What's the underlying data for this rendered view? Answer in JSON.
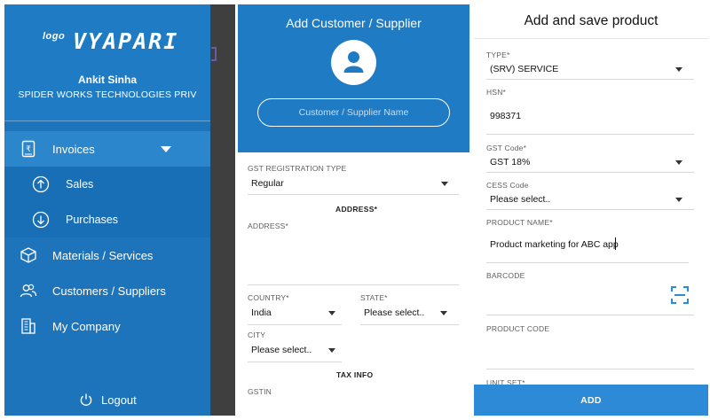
{
  "nav_drawer": {
    "brand_small": "logo",
    "brand_big": "VYAPARI",
    "user_name": "Ankit Sinha",
    "company": "SPIDER WORKS TECHNOLOGIES PRIV",
    "items": [
      {
        "label": "Invoices",
        "icon": "invoice-icon"
      },
      {
        "label": "Sales",
        "icon": "arrow-up-circle-icon"
      },
      {
        "label": "Purchases",
        "icon": "arrow-down-circle-icon"
      },
      {
        "label": "Materials / Services",
        "icon": "box-icon"
      },
      {
        "label": "Customers / Suppliers",
        "icon": "people-icon"
      },
      {
        "label": "My Company",
        "icon": "building-icon"
      }
    ],
    "logout_label": "Logout"
  },
  "customer_form": {
    "title": "Add Customer / Supplier",
    "name_placeholder": "Customer / Supplier Name",
    "gst_type_label": "GST REGISTRATION TYPE",
    "gst_type_value": "Regular",
    "address_heading": "ADDRESS*",
    "address_label": "ADDRESS*",
    "country_label": "COUNTRY*",
    "country_value": "India",
    "state_label": "STATE*",
    "state_value": "Please select..",
    "city_label": "CITY",
    "city_value": "Please select..",
    "tax_heading": "TAX INFO",
    "gstin_label": "GSTIN"
  },
  "product_form": {
    "title": "Add and save product",
    "type_label": "TYPE*",
    "type_value": "(SRV) SERVICE",
    "hsn_label": "HSN*",
    "hsn_value": "998371",
    "gst_code_label": "GST Code*",
    "gst_code_value": "GST 18%",
    "cess_label": "CESS Code",
    "cess_value": "Please select..",
    "product_name_label": "PRODUCT NAME*",
    "product_name_value": "Product marketing for ABC app",
    "barcode_label": "BARCODE",
    "product_code_label": "PRODUCT CODE",
    "unit_set_label": "UNIT SET*",
    "add_button": "ADD"
  },
  "colors": {
    "drawer_blue": "#1d74bb",
    "header_blue": "#1f7bc4",
    "button_blue": "#2d8ad6",
    "scrim": "#3d3d3d"
  }
}
